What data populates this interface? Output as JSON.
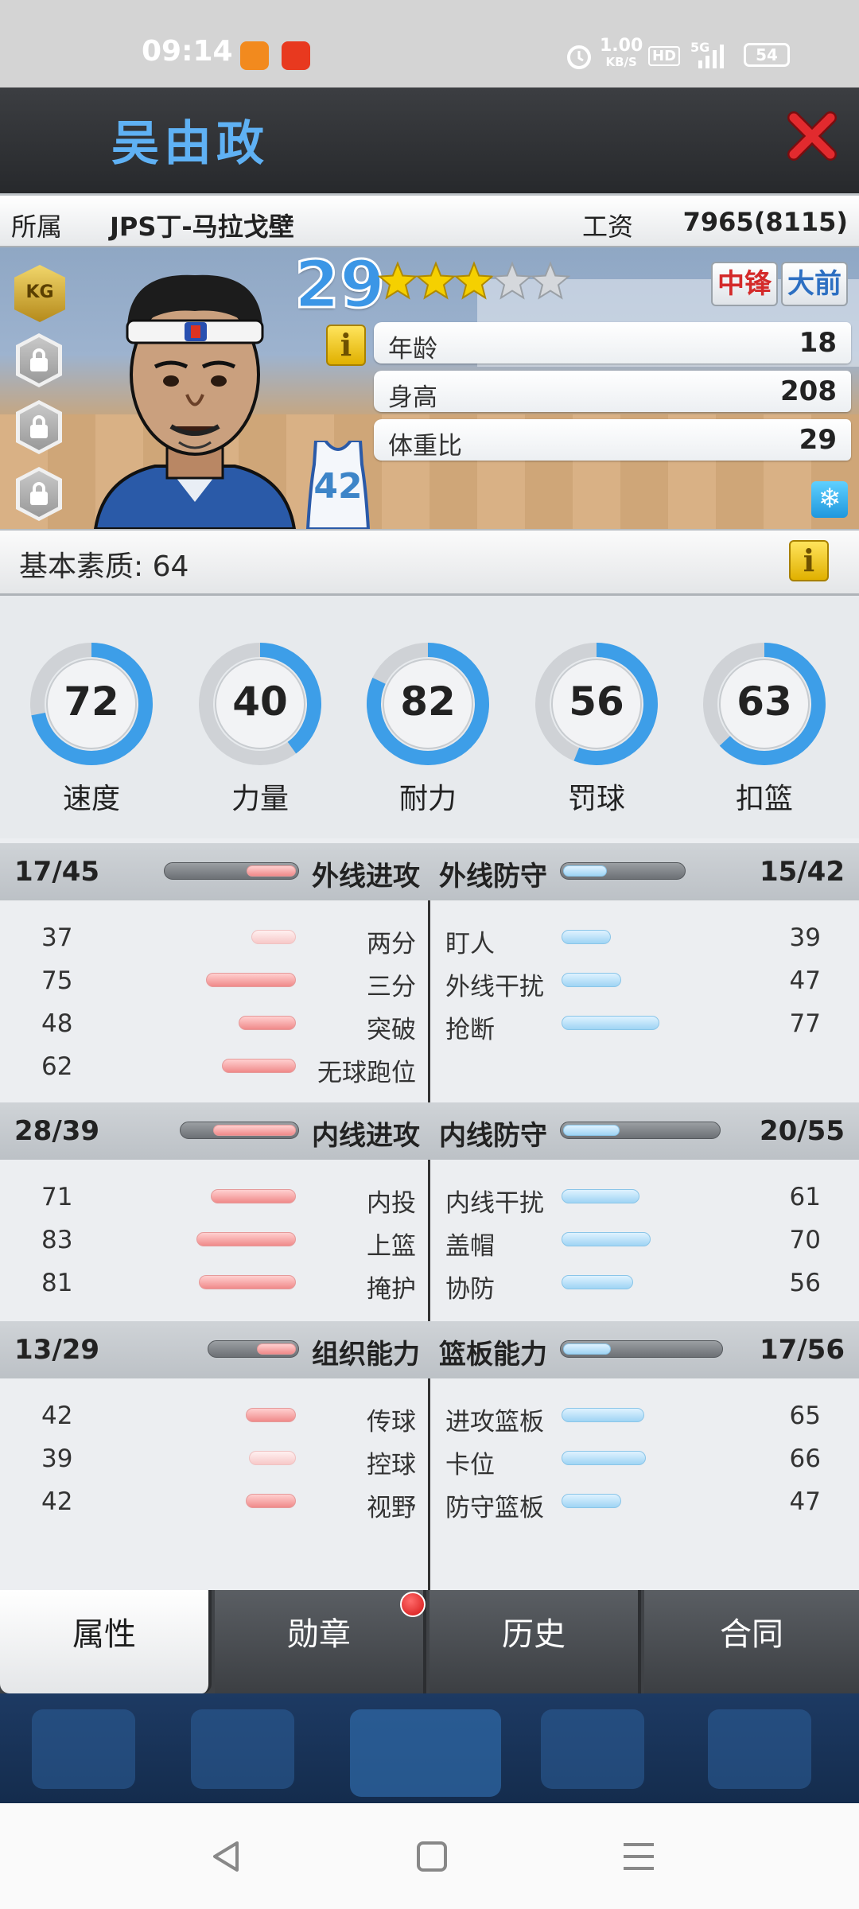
{
  "status_bar": {
    "time": "09:14",
    "net_speed_value": "1.00",
    "net_speed_unit": "KB/S",
    "hd": "HD",
    "signal": "5G",
    "battery": "54"
  },
  "header": {
    "player_name": "吴由政"
  },
  "info": {
    "team_label": "所属",
    "team_value": "JPS丁-马拉戈壁",
    "salary_label": "工资",
    "salary_value": "7965(8115)"
  },
  "card": {
    "badge": "KG",
    "jersey": "42",
    "overall": "29",
    "stars": 3,
    "stars_total": 5,
    "positions": [
      "中锋",
      "大前"
    ],
    "info_icon": "i",
    "stats": [
      {
        "label": "年龄",
        "value": "18"
      },
      {
        "label": "身高",
        "value": "208"
      },
      {
        "label": "体重比",
        "value": "29"
      }
    ]
  },
  "base": {
    "label": "基本素质: 64",
    "info_icon": "i"
  },
  "gauges": [
    {
      "label": "速度",
      "value": "72",
      "pct": 72
    },
    {
      "label": "力量",
      "value": "40",
      "pct": 40
    },
    {
      "label": "耐力",
      "value": "82",
      "pct": 82
    },
    {
      "label": "罚球",
      "value": "56",
      "pct": 56
    },
    {
      "label": "扣篮",
      "value": "63",
      "pct": 63
    }
  ],
  "sections": [
    {
      "left_score": "17/45",
      "left_title": "外线进攻",
      "right_title": "外线防守",
      "right_score": "15/42",
      "left_fill": 0.38,
      "right_fill": 0.36,
      "left_rows": [
        {
          "value": "37",
          "label": "两分",
          "pct": 37
        },
        {
          "value": "75",
          "label": "三分",
          "pct": 75
        },
        {
          "value": "48",
          "label": "突破",
          "pct": 48
        },
        {
          "value": "62",
          "label": "无球跑位",
          "pct": 62
        }
      ],
      "right_rows": [
        {
          "label": "盯人",
          "value": "39",
          "pct": 39
        },
        {
          "label": "外线干扰",
          "value": "47",
          "pct": 47
        },
        {
          "label": "抢断",
          "value": "77",
          "pct": 77
        }
      ]
    },
    {
      "left_score": "28/39",
      "left_title": "内线进攻",
      "right_title": "内线防守",
      "right_score": "20/55",
      "left_fill": 0.72,
      "right_fill": 0.36,
      "left_rows": [
        {
          "value": "71",
          "label": "内投",
          "pct": 71
        },
        {
          "value": "83",
          "label": "上篮",
          "pct": 83
        },
        {
          "value": "81",
          "label": "掩护",
          "pct": 81
        }
      ],
      "right_rows": [
        {
          "label": "内线干扰",
          "value": "61",
          "pct": 61
        },
        {
          "label": "盖帽",
          "value": "70",
          "pct": 70
        },
        {
          "label": "协防",
          "value": "56",
          "pct": 56
        }
      ]
    },
    {
      "left_score": "13/29",
      "left_title": "组织能力",
      "right_title": "篮板能力",
      "right_score": "17/56",
      "left_fill": 0.45,
      "right_fill": 0.3,
      "left_rows": [
        {
          "value": "42",
          "label": "传球",
          "pct": 42
        },
        {
          "value": "39",
          "label": "控球",
          "pct": 39
        },
        {
          "value": "42",
          "label": "视野",
          "pct": 42
        }
      ],
      "right_rows": [
        {
          "label": "进攻篮板",
          "value": "65",
          "pct": 65
        },
        {
          "label": "卡位",
          "value": "66",
          "pct": 66
        },
        {
          "label": "防守篮板",
          "value": "47",
          "pct": 47
        }
      ]
    }
  ],
  "tabs": [
    {
      "label": "属性",
      "active": true
    },
    {
      "label": "勋章",
      "active": false,
      "notify": true
    },
    {
      "label": "历史",
      "active": false
    },
    {
      "label": "合同",
      "active": false
    }
  ],
  "colors": {
    "accent_blue": "#3d9ee8",
    "name_blue": "#5fb1f4",
    "close_red": "#d8262a",
    "star_gold": "#f5d000",
    "bar_pink": "#f08a8a",
    "bar_blue": "#9fd4f4"
  }
}
